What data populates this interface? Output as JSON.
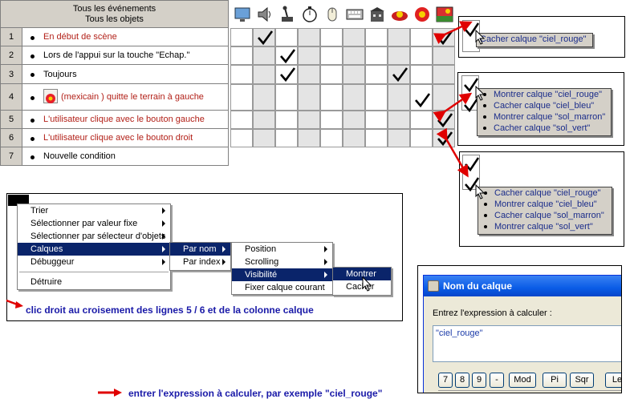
{
  "events_header": {
    "line1": "Tous les événements",
    "line2": "Tous les objets"
  },
  "events": [
    {
      "num": "1",
      "label": "En début de scène",
      "color": "red"
    },
    {
      "num": "2",
      "label": "Lors de l'appui sur la touche \"Echap.\"",
      "color": "black"
    },
    {
      "num": "3",
      "label": "Toujours",
      "color": "black"
    },
    {
      "num": "4",
      "label": "(mexicain ) quitte le terrain à gauche",
      "color": "red",
      "has_icon": true
    },
    {
      "num": "5",
      "label": "L'utilisateur clique avec le bouton gauche",
      "color": "red"
    },
    {
      "num": "6",
      "label": "L'utilisateur clique avec le bouton droit",
      "color": "red"
    },
    {
      "num": "7",
      "label": "Nouvelle condition",
      "color": "black"
    }
  ],
  "object_columns": [
    {
      "icon": "monitor-icon"
    },
    {
      "icon": "speaker-icon"
    },
    {
      "icon": "joystick-icon"
    },
    {
      "icon": "timer-icon"
    },
    {
      "icon": "mouse-icon"
    },
    {
      "icon": "keyboard-icon"
    },
    {
      "icon": "building-icon"
    },
    {
      "icon": "sombrero-icon"
    },
    {
      "icon": "sombrero-red-icon"
    },
    {
      "icon": "landscape-icon"
    }
  ],
  "checks": [
    {
      "row": 1,
      "col": 2
    },
    {
      "row": 1,
      "col": 10
    },
    {
      "row": 2,
      "col": 3
    },
    {
      "row": 3,
      "col": 3
    },
    {
      "row": 3,
      "col": 8
    },
    {
      "row": 4,
      "col": 9
    },
    {
      "row": 5,
      "col": 10
    },
    {
      "row": 6,
      "col": 10
    }
  ],
  "popup1": {
    "items": [
      "Cacher calque \"ciel_rouge\""
    ]
  },
  "popup2": {
    "items": [
      "Montrer calque \"ciel_rouge\"",
      "Cacher calque \"ciel_bleu\"",
      "Montrer calque \"sol_marron\"",
      "Cacher calque \"sol_vert\""
    ]
  },
  "popup3": {
    "items": [
      "Cacher calque \"ciel_rouge\"",
      "Montrer calque \"ciel_bleu\"",
      "Cacher calque \"sol_marron\"",
      "Montrer calque \"sol_vert\""
    ]
  },
  "context_menu": {
    "items": [
      "Trier",
      "Sélectionner par valeur fixe",
      "Sélectionner par sélecteur d'objets",
      "Calques",
      "Débuggeur",
      "Détruire"
    ],
    "selected": "Calques"
  },
  "submenu_calques": {
    "items": [
      "Par nom",
      "Par index"
    ],
    "selected": "Par nom"
  },
  "submenu_parnom": {
    "items": [
      "Position",
      "Scrolling",
      "Visibilité",
      "Fixer calque courant"
    ],
    "selected": "Visibilité"
  },
  "submenu_visibilite": {
    "items": [
      "Montrer",
      "Cacher"
    ],
    "selected": "Montrer"
  },
  "note_right_click": "clic droit au croisement des lignes 5 / 6 et de la colonne calque",
  "note_expression": "entrer l'expression à calculer, par exemple \"ciel_rouge\"",
  "dialog": {
    "title": "Nom du calque",
    "prompt": "Entrez l'expression à calculer :",
    "input_value": "\"ciel_rouge\"",
    "buttons": [
      "7",
      "8",
      "9",
      "-",
      "Mod",
      "Pi",
      "Sqr",
      "Le"
    ]
  },
  "colors": {
    "red_label": "#b22018",
    "blue_note": "#1a1aa8",
    "arrow_red": "#e00000",
    "menu_highlight": "#0a246a"
  }
}
